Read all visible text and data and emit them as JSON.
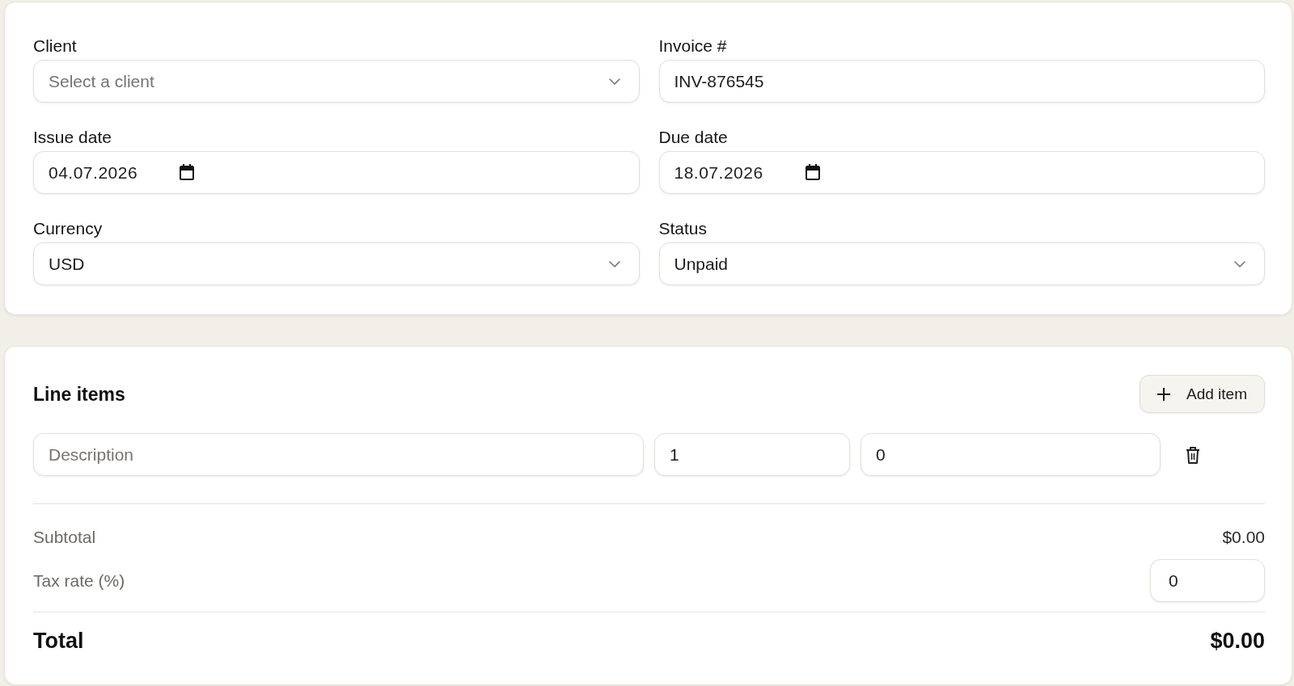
{
  "invoice_details": {
    "fields": [
      {
        "kind": "select",
        "label": "Client",
        "placeholder": "Select a client"
      },
      {
        "kind": "text",
        "label": "Invoice #",
        "value": "INV-876545"
      },
      {
        "kind": "date",
        "label": "Issue date",
        "value": "04.07.2026"
      },
      {
        "kind": "date",
        "label": "Due date",
        "value": "18.07.2026"
      },
      {
        "kind": "select",
        "label": "Currency",
        "value": "USD"
      },
      {
        "kind": "select",
        "label": "Status",
        "value": "Unpaid"
      }
    ]
  },
  "line_items": {
    "title": "Line items",
    "add_button": "Add item",
    "items": [
      {
        "fields": [
          {
            "placeholder": "Description"
          },
          {
            "value": "1"
          },
          {
            "value": "0"
          }
        ]
      }
    ]
  },
  "totals": {
    "subtotal": {
      "label": "Subtotal",
      "value": "$0.00"
    },
    "tax_rate": {
      "label": "Tax rate (%)",
      "value": "0"
    },
    "total": {
      "label": "Total",
      "value": "$0.00"
    }
  }
}
